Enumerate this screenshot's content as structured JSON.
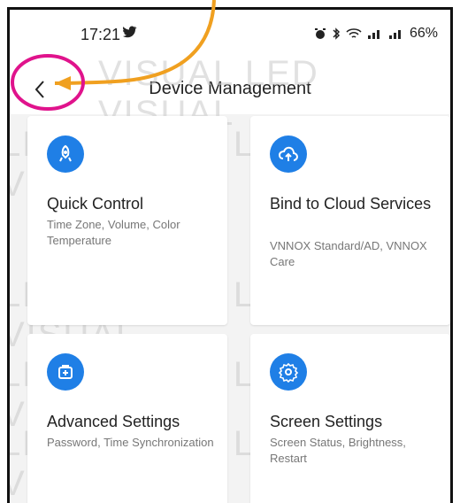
{
  "status_bar": {
    "time": "17:21",
    "social_icon": "twitter-icon",
    "right_text": "66%",
    "icons": [
      "alarm-icon",
      "bluetooth-icon",
      "wifi-icon",
      "signal-icon",
      "signal-icon"
    ]
  },
  "header": {
    "title": "Device Management",
    "back_icon": "chevron-left-icon"
  },
  "cards": [
    {
      "title": "Quick Control",
      "subtitle": "Time Zone, Volume, Color Temperature",
      "icon": "rocket-icon"
    },
    {
      "title": "Bind to Cloud Services",
      "subtitle": "VNNOX Standard/AD, VNNOX Care",
      "icon": "cloud-upload-icon"
    },
    {
      "title": "Advanced Settings",
      "subtitle": "Password, Time Synchronization",
      "icon": "briefcase-plus-icon"
    },
    {
      "title": "Screen Settings",
      "subtitle": "Screen Status, Brightness, Restart",
      "icon": "gear-icon"
    }
  ],
  "colors": {
    "accent": "#1f7fe6",
    "annotation_circle": "#e0138c",
    "annotation_arrow": "#f0a020"
  }
}
